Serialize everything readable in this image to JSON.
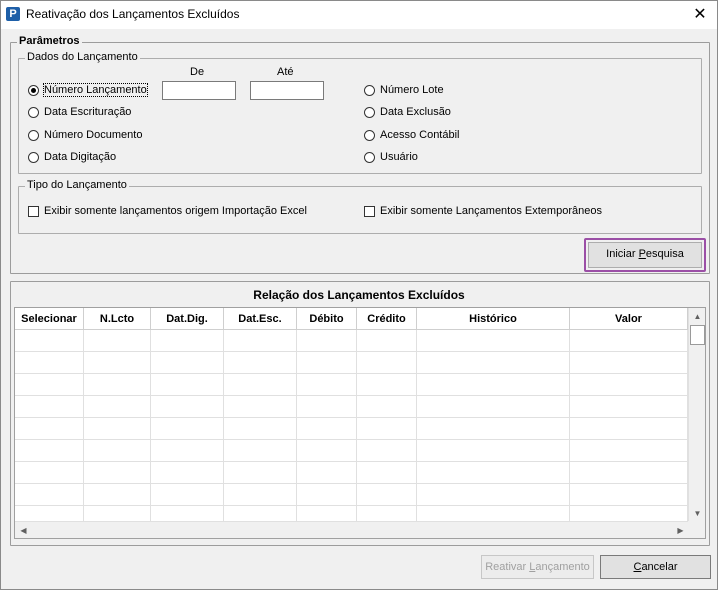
{
  "window": {
    "title": "Reativação dos Lançamentos Excluídos",
    "close_symbol": "✕",
    "app_icon_letter": "P"
  },
  "parametros": {
    "legend": "Parâmetros",
    "dados": {
      "legend": "Dados do Lançamento",
      "col_de": "De",
      "col_ate": "Até",
      "de_value": "",
      "ate_value": "",
      "options_left": [
        {
          "label": "Número Lançamento",
          "checked": true
        },
        {
          "label": "Data Escrituração",
          "checked": false
        },
        {
          "label": "Número Documento",
          "checked": false
        },
        {
          "label": "Data Digitação",
          "checked": false
        }
      ],
      "options_right": [
        {
          "label": "Número Lote",
          "checked": false
        },
        {
          "label": "Data Exclusão",
          "checked": false
        },
        {
          "label": "Acesso Contábil",
          "checked": false
        },
        {
          "label": "Usuário",
          "checked": false
        }
      ]
    },
    "tipo": {
      "legend": "Tipo do Lançamento",
      "check_excel": "Exibir somente lançamentos origem Importação Excel",
      "check_extemp": "Exibir somente Lançamentos Extemporâneos"
    },
    "search_button": {
      "pre": "Iniciar ",
      "accel": "P",
      "post": "esquisa"
    }
  },
  "grid": {
    "title": "Relação dos Lançamentos Excluídos",
    "columns": [
      "Selecionar",
      "N.Lcto",
      "Dat.Dig.",
      "Dat.Esc.",
      "Débito",
      "Crédito",
      "Histórico",
      "Valor"
    ],
    "rows": []
  },
  "footer": {
    "reativar": {
      "pre": "Reativar ",
      "accel": "L",
      "post": "ançamento"
    },
    "cancelar": {
      "pre": "",
      "accel": "C",
      "post": "ancelar"
    }
  },
  "colors": {
    "highlight_border": "#9b4fa6",
    "app_icon_bg": "#1e5fa8"
  }
}
